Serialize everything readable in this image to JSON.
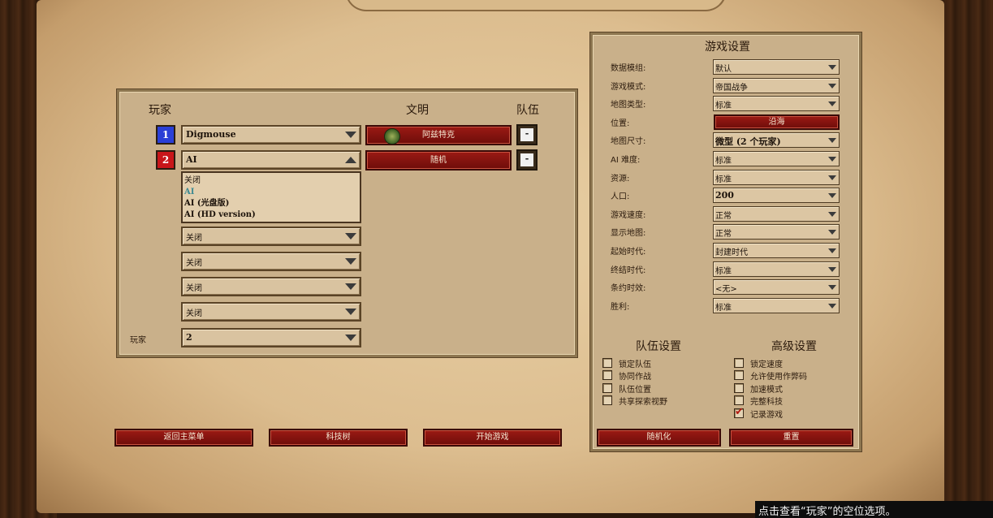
{
  "players_panel": {
    "header_player": "玩家",
    "header_civ": "文明",
    "header_team": "队伍",
    "players": [
      {
        "number": "1",
        "color": "#2a3fd6",
        "name": "Digmouse",
        "civ": "阿兹特克",
        "team": "-"
      },
      {
        "number": "2",
        "color": "#c8161a",
        "name": "AI",
        "civ": "随机",
        "team": "-"
      }
    ],
    "dropdown_open_options": [
      "关闭",
      "AI",
      "AI (光盘版)",
      "AI (HD version)"
    ],
    "empty_slots": [
      "关闭",
      "关闭",
      "关闭",
      "关闭"
    ],
    "player_count_label": "玩家",
    "player_count_value": "2"
  },
  "game_settings": {
    "title": "游戏设置",
    "rows": [
      {
        "label": "数据模组:",
        "value": "默认"
      },
      {
        "label": "游戏模式:",
        "value": "帝国战争"
      },
      {
        "label": "地图类型:",
        "value": "标准"
      },
      {
        "label": "位置:",
        "value": "沿海"
      },
      {
        "label": "地图尺寸:",
        "value": "微型 (2 个玩家)"
      },
      {
        "label": "AI 难度:",
        "value": "标准"
      },
      {
        "label": "资源:",
        "value": "标准"
      },
      {
        "label": "人口:",
        "value": "200"
      },
      {
        "label": "游戏速度:",
        "value": "正常"
      },
      {
        "label": "显示地图:",
        "value": "正常"
      },
      {
        "label": "起始时代:",
        "value": "封建时代"
      },
      {
        "label": "终结时代:",
        "value": "标准"
      },
      {
        "label": "条约时效:",
        "value": "<无>"
      },
      {
        "label": "胜利:",
        "value": "标准"
      }
    ]
  },
  "team_settings": {
    "title": "队伍设置",
    "options": [
      {
        "label": "锁定队伍",
        "checked": false
      },
      {
        "label": "协同作战",
        "checked": false
      },
      {
        "label": "队伍位置",
        "checked": false
      },
      {
        "label": "共享探索视野",
        "checked": false
      }
    ]
  },
  "advanced_settings": {
    "title": "高级设置",
    "options": [
      {
        "label": "锁定速度",
        "checked": false
      },
      {
        "label": "允许使用作弊码",
        "checked": false
      },
      {
        "label": "加速模式",
        "checked": false
      },
      {
        "label": "完整科技",
        "checked": false
      },
      {
        "label": "记录游戏",
        "checked": true
      }
    ]
  },
  "buttons": {
    "main_menu": "返回主菜单",
    "tech_tree": "科技树",
    "start_game": "开始游戏",
    "randomize": "随机化",
    "reset": "重置"
  },
  "tooltip": "点击查看“玩家”的空位选项。"
}
